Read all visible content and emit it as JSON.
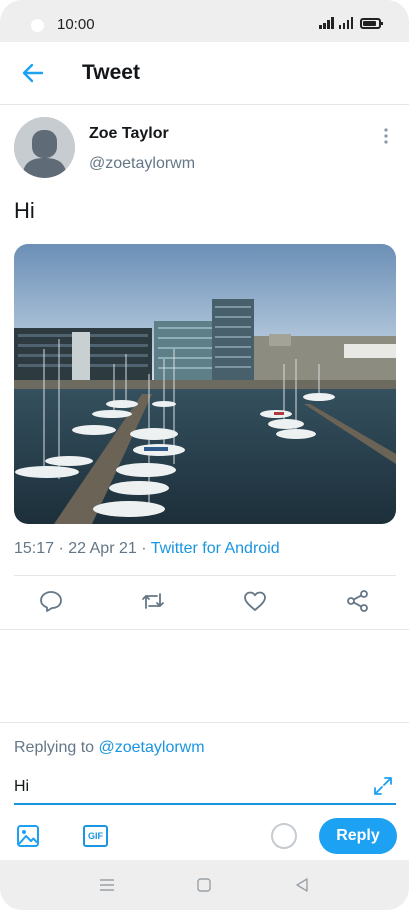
{
  "status_bar": {
    "time": "10:00"
  },
  "header": {
    "title": "Tweet"
  },
  "tweet": {
    "author_name": "Zoe Taylor",
    "author_handle": "@zoetaylorwm",
    "text": "Hi",
    "time": "15:17 · 22 Apr 21 · ",
    "source": "Twitter for Android"
  },
  "actions": [
    "reply-icon",
    "retweet-icon",
    "like-icon",
    "share-icon"
  ],
  "composer": {
    "replying_label": "Replying to ",
    "replying_handle": "@zoetaylorwm",
    "input_value": "Hi",
    "gif_label": "GIF",
    "reply_button": "Reply"
  },
  "colors": {
    "accent": "#1da1f2",
    "link": "#1b95e0",
    "muted": "#657786"
  }
}
